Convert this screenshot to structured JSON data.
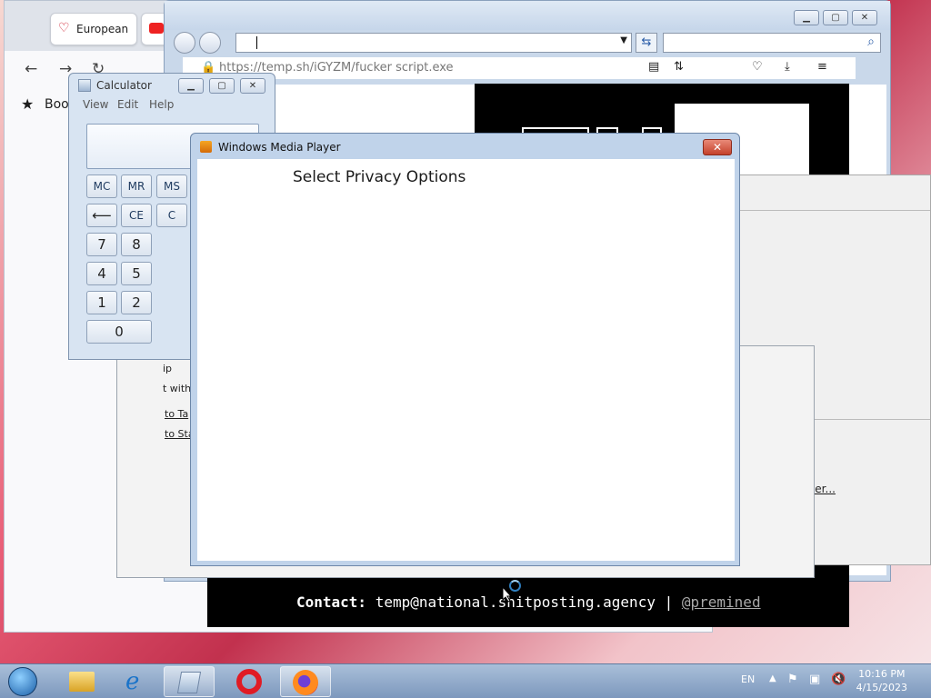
{
  "firefox_back": {
    "tabs": [
      {
        "label": "European"
      }
    ],
    "bookmarks_label": "Boo"
  },
  "ie": {
    "url": "https://temp.sh/iGYZM/fucker script.exe"
  },
  "calculator": {
    "title": "Calculator",
    "menu": [
      "View",
      "Edit",
      "Help"
    ],
    "memory_buttons": [
      "MC",
      "MR",
      "MS"
    ],
    "edit_buttons": [
      "⟵",
      "CE",
      "C"
    ],
    "digits": [
      "7",
      "8",
      "4",
      "5",
      "1",
      "2",
      "0"
    ]
  },
  "mid_window": {
    "lines": [
      "ip",
      "t with",
      "to Ta",
      "to Sta"
    ]
  },
  "ccleaner": {
    "link": "Open CCleaner..."
  },
  "wmp": {
    "title": "Windows Media Player",
    "close_glyph": "✕",
    "heading": "Select Privacy Options"
  },
  "contact": {
    "label": "Contact:",
    "email": "temp@national.shitposting.agency",
    "sep": "|",
    "handle": "@premined"
  },
  "taskbar": {
    "language": "EN",
    "time": "10:16 PM",
    "date": "4/15/2023"
  },
  "colors": {
    "taskbar": "#7d98bd",
    "wmp_close": "#c4412b"
  }
}
